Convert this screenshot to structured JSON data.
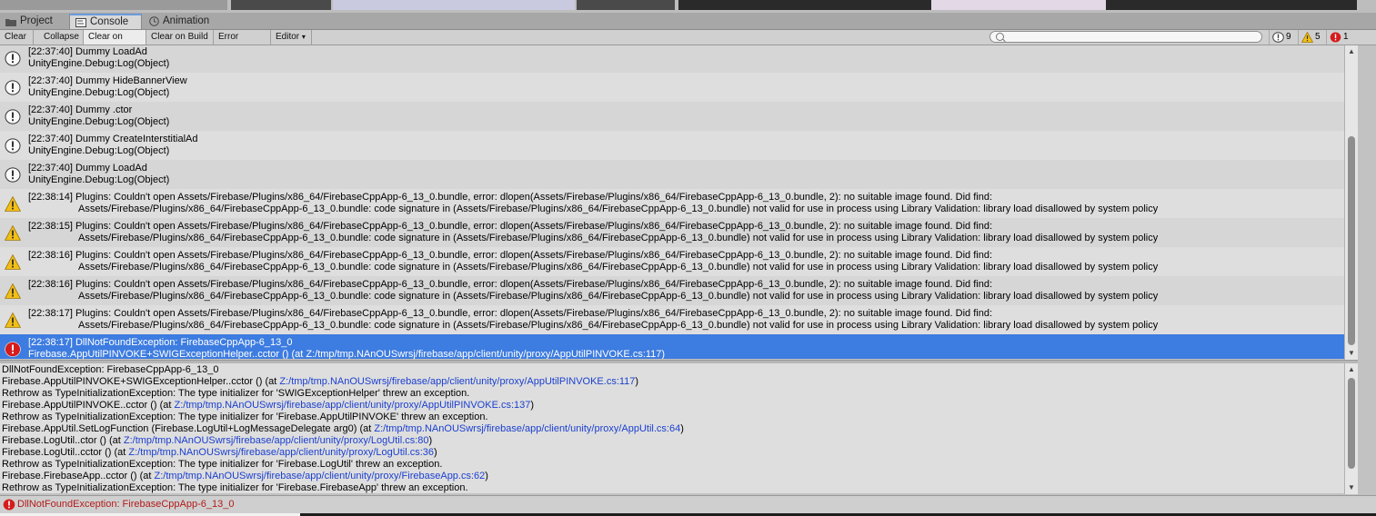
{
  "tabs": [
    {
      "label": "Project",
      "icon": "folder-icon"
    },
    {
      "label": "Console",
      "icon": "console-icon"
    },
    {
      "label": "Animation",
      "icon": "clock-icon"
    }
  ],
  "toolbar": {
    "clear": "Clear",
    "collapse": "Collapse",
    "clear_on_play": "Clear on Play",
    "clear_on_build": "Clear on Build",
    "error_pause": "Error Pause",
    "editor": "Editor",
    "editor_arrow": "▾",
    "search_placeholder": ""
  },
  "counts": {
    "info": "9",
    "warning": "5",
    "error": "1"
  },
  "colors": {
    "accent": "#3d7ce0",
    "error": "#d51c1c",
    "warning": "#f2bf16",
    "link": "#1a3fd0"
  },
  "log_entries": [
    {
      "type": "info",
      "line1": "[22:37:40] Dummy LoadAd",
      "line2": "UnityEngine.Debug:Log(Object)"
    },
    {
      "type": "info",
      "line1": "[22:37:40] Dummy HideBannerView",
      "line2": "UnityEngine.Debug:Log(Object)"
    },
    {
      "type": "info",
      "line1": "[22:37:40] Dummy .ctor",
      "line2": "UnityEngine.Debug:Log(Object)"
    },
    {
      "type": "info",
      "line1": "[22:37:40] Dummy CreateInterstitialAd",
      "line2": "UnityEngine.Debug:Log(Object)"
    },
    {
      "type": "info",
      "line1": "[22:37:40] Dummy LoadAd",
      "line2": "UnityEngine.Debug:Log(Object)"
    },
    {
      "type": "warning",
      "line1": "[22:38:14] Plugins: Couldn't open Assets/Firebase/Plugins/x86_64/FirebaseCppApp-6_13_0.bundle, error: dlopen(Assets/Firebase/Plugins/x86_64/FirebaseCppApp-6_13_0.bundle, 2): no suitable image found.  Did find:",
      "line2": "Assets/Firebase/Plugins/x86_64/FirebaseCppApp-6_13_0.bundle: code signature in (Assets/Firebase/Plugins/x86_64/FirebaseCppApp-6_13_0.bundle) not valid for use in process using Library Validation: library load disallowed by system policy"
    },
    {
      "type": "warning",
      "line1": "[22:38:15] Plugins: Couldn't open Assets/Firebase/Plugins/x86_64/FirebaseCppApp-6_13_0.bundle, error: dlopen(Assets/Firebase/Plugins/x86_64/FirebaseCppApp-6_13_0.bundle, 2): no suitable image found.  Did find:",
      "line2": "Assets/Firebase/Plugins/x86_64/FirebaseCppApp-6_13_0.bundle: code signature in (Assets/Firebase/Plugins/x86_64/FirebaseCppApp-6_13_0.bundle) not valid for use in process using Library Validation: library load disallowed by system policy"
    },
    {
      "type": "warning",
      "line1": "[22:38:16] Plugins: Couldn't open Assets/Firebase/Plugins/x86_64/FirebaseCppApp-6_13_0.bundle, error: dlopen(Assets/Firebase/Plugins/x86_64/FirebaseCppApp-6_13_0.bundle, 2): no suitable image found.  Did find:",
      "line2": "Assets/Firebase/Plugins/x86_64/FirebaseCppApp-6_13_0.bundle: code signature in (Assets/Firebase/Plugins/x86_64/FirebaseCppApp-6_13_0.bundle) not valid for use in process using Library Validation: library load disallowed by system policy"
    },
    {
      "type": "warning",
      "line1": "[22:38:16] Plugins: Couldn't open Assets/Firebase/Plugins/x86_64/FirebaseCppApp-6_13_0.bundle, error: dlopen(Assets/Firebase/Plugins/x86_64/FirebaseCppApp-6_13_0.bundle, 2): no suitable image found.  Did find:",
      "line2": "Assets/Firebase/Plugins/x86_64/FirebaseCppApp-6_13_0.bundle: code signature in (Assets/Firebase/Plugins/x86_64/FirebaseCppApp-6_13_0.bundle) not valid for use in process using Library Validation: library load disallowed by system policy"
    },
    {
      "type": "warning",
      "line1": "[22:38:17] Plugins: Couldn't open Assets/Firebase/Plugins/x86_64/FirebaseCppApp-6_13_0.bundle, error: dlopen(Assets/Firebase/Plugins/x86_64/FirebaseCppApp-6_13_0.bundle, 2): no suitable image found.  Did find:",
      "line2": "Assets/Firebase/Plugins/x86_64/FirebaseCppApp-6_13_0.bundle: code signature in (Assets/Firebase/Plugins/x86_64/FirebaseCppApp-6_13_0.bundle) not valid for use in process using Library Validation: library load disallowed by system policy"
    },
    {
      "type": "error",
      "selected": true,
      "line1": "[22:38:17] DllNotFoundException: FirebaseCppApp-6_13_0",
      "line2": "Firebase.AppUtilPINVOKE+SWIGExceptionHelper..cctor () (at Z:/tmp/tmp.NAnOUSwrsj/firebase/app/client/unity/proxy/AppUtilPINVOKE.cs:117)"
    }
  ],
  "detail_lines": [
    {
      "text": "DllNotFoundException: FirebaseCppApp-6_13_0",
      "link": ""
    },
    {
      "text": "Firebase.AppUtilPINVOKE+SWIGExceptionHelper..cctor () (at ",
      "link": "Z:/tmp/tmp.NAnOUSwrsj/firebase/app/client/unity/proxy/AppUtilPINVOKE.cs:117",
      "tail": ")"
    },
    {
      "text": "Rethrow as TypeInitializationException: The type initializer for 'SWIGExceptionHelper' threw an exception.",
      "link": ""
    },
    {
      "text": "Firebase.AppUtilPINVOKE..cctor () (at ",
      "link": "Z:/tmp/tmp.NAnOUSwrsj/firebase/app/client/unity/proxy/AppUtilPINVOKE.cs:137",
      "tail": ")"
    },
    {
      "text": "Rethrow as TypeInitializationException: The type initializer for 'Firebase.AppUtilPINVOKE' threw an exception.",
      "link": ""
    },
    {
      "text": "Firebase.AppUtil.SetLogFunction (Firebase.LogUtil+LogMessageDelegate arg0) (at ",
      "link": "Z:/tmp/tmp.NAnOUSwrsj/firebase/app/client/unity/proxy/AppUtil.cs:64",
      "tail": ")"
    },
    {
      "text": "Firebase.LogUtil..ctor () (at ",
      "link": "Z:/tmp/tmp.NAnOUSwrsj/firebase/app/client/unity/proxy/LogUtil.cs:80",
      "tail": ")"
    },
    {
      "text": "Firebase.LogUtil..cctor () (at ",
      "link": "Z:/tmp/tmp.NAnOUSwrsj/firebase/app/client/unity/proxy/LogUtil.cs:36",
      "tail": ")"
    },
    {
      "text": "Rethrow as TypeInitializationException: The type initializer for 'Firebase.LogUtil' threw an exception.",
      "link": ""
    },
    {
      "text": "Firebase.FirebaseApp..cctor () (at ",
      "link": "Z:/tmp/tmp.NAnOUSwrsj/firebase/app/client/unity/proxy/FirebaseApp.cs:62",
      "tail": ")"
    },
    {
      "text": "Rethrow as TypeInitializationException: The type initializer for 'Firebase.FirebaseApp' threw an exception.",
      "link": ""
    }
  ],
  "status": {
    "text": "DllNotFoundException: FirebaseCppApp-6_13_0"
  }
}
